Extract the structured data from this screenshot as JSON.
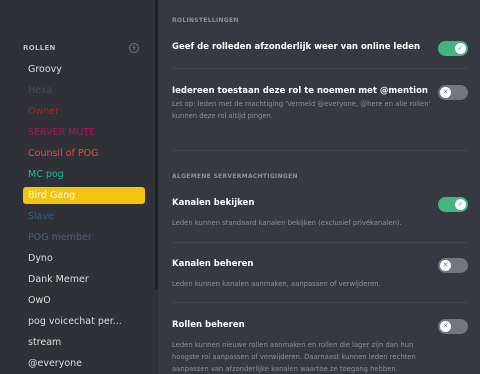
{
  "sidebar": {
    "header": "ROLLEN",
    "add_icon": "plus-circle-icon",
    "roles": [
      {
        "name": "Groovy",
        "color": "#dcddde"
      },
      {
        "name": "Hexa",
        "color": "#4b4d52"
      },
      {
        "name": "Owner",
        "color": "#992d22"
      },
      {
        "name": "SERVER MUTE",
        "color": "#ad1457"
      },
      {
        "name": "Counsil of POG",
        "color": "#e74c3c"
      },
      {
        "name": "MC pog",
        "color": "#1abc9c"
      },
      {
        "name": "Bird Gang",
        "color": "#ffffff"
      },
      {
        "name": "Slave",
        "color": "#206694"
      },
      {
        "name": "POG member",
        "color": "#4f5d7e"
      },
      {
        "name": "Dyno",
        "color": "#dcddde"
      },
      {
        "name": "Dank Memer",
        "color": "#dcddde"
      },
      {
        "name": "OwO",
        "color": "#dcddde"
      },
      {
        "name": "pog voicechat per...",
        "color": "#dcddde"
      },
      {
        "name": "stream",
        "color": "#dcddde"
      },
      {
        "name": "@everyone",
        "color": "#dcddde"
      }
    ],
    "selected_role": "Bird Gang",
    "selected_color": "#f1c40f"
  },
  "main": {
    "role_settings_title": "ROLINSTELLINGEN",
    "setting_display_separately": {
      "label": "Geef de rolleden afzonderlijk weer van online leden",
      "enabled": true
    },
    "setting_mention": {
      "label": "Iedereen toestaan deze rol te noemen met @mention",
      "description": "Let op: leden met de machtiging 'Vermeld @everyone, @here en alle rollen' kunnen deze rol altijd pingen.",
      "enabled": false
    },
    "general_permissions_title": "ALGEMENE SERVERMACHTIGINGEN",
    "perm_view_channels": {
      "label": "Kanalen bekijken",
      "description": "Leden kunnen standaard kanalen bekijken (exclusief privékanalen).",
      "enabled": true
    },
    "perm_manage_channels": {
      "label": "Kanalen beheren",
      "description": "Leden kunnen kanalen aanmaken, aanpassen of verwijderen.",
      "enabled": false
    },
    "perm_manage_roles": {
      "label": "Rollen beheren",
      "description_lines": [
        "Leden kunnen nieuwe rollen aanmaken en rollen die lager zijn dan hun",
        "hoogste rol aanpassen of verwijderen. Daarnaast kunnen leden rechten",
        "aanpassen van afzonderlijke kanalen waartoe ze toegang hebben."
      ],
      "enabled": false
    },
    "toggle_on_icon": "check-icon",
    "toggle_off_icon": "x-icon",
    "toggle_on_color": "#43b581",
    "toggle_off_color": "#72767d"
  }
}
